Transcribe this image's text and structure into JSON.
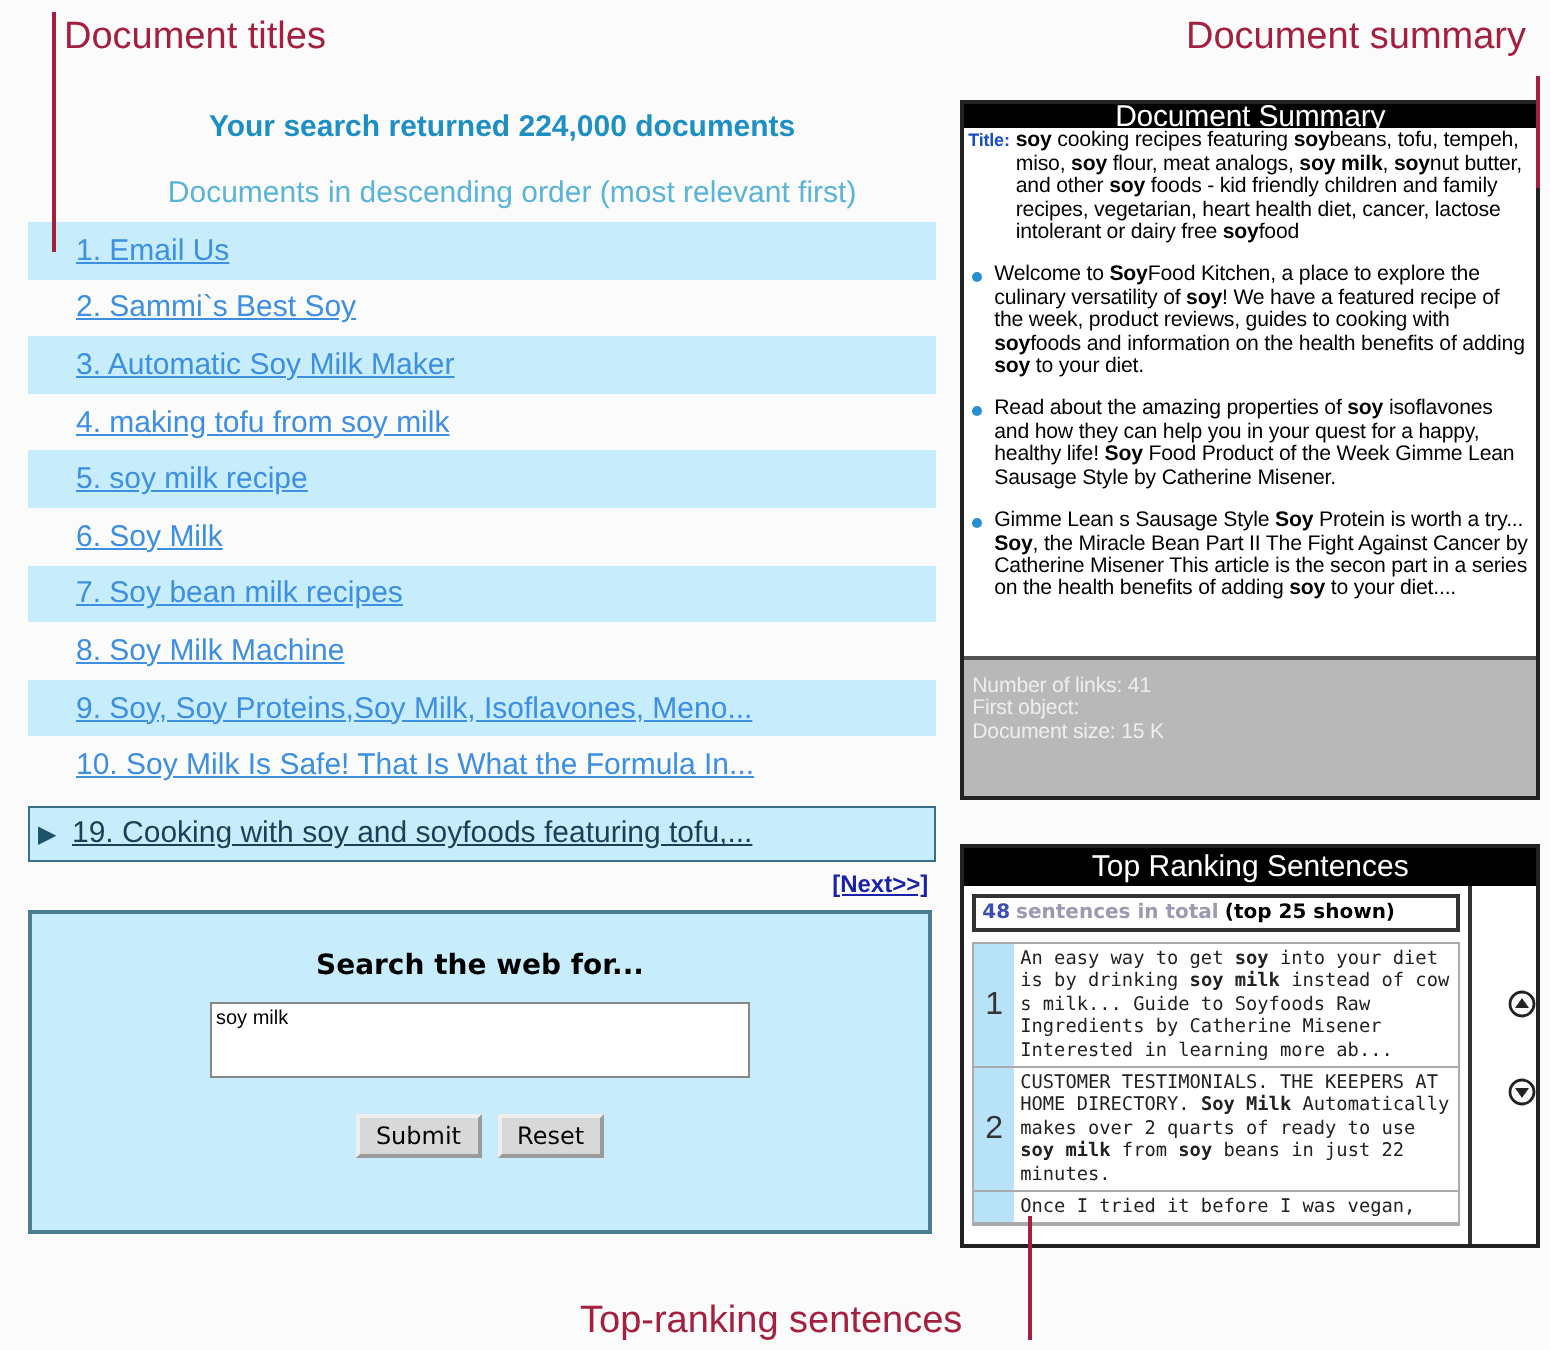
{
  "callouts": {
    "top_left": "Document titles",
    "top_right": "Document summary",
    "bottom": "Top-ranking sentences"
  },
  "results": {
    "heading": "Your search returned 224,000 documents",
    "subheading": "Documents in descending order (most relevant first)",
    "documents": [
      {
        "title": "1. Email Us",
        "selected": false
      },
      {
        "title": "2. Sammi`s Best Soy",
        "selected": false
      },
      {
        "title": "3. Automatic Soy Milk Maker",
        "selected": false
      },
      {
        "title": "4. making tofu from soy milk",
        "selected": false
      },
      {
        "title": "5. soy milk recipe",
        "selected": false
      },
      {
        "title": "6. Soy Milk",
        "selected": false
      },
      {
        "title": "7. Soy bean milk recipes",
        "selected": false
      },
      {
        "title": "8. Soy Milk Machine",
        "selected": false
      },
      {
        "title": "9. Soy, Soy Proteins,Soy Milk, Isoflavones, Meno...",
        "selected": false
      },
      {
        "title": "10. Soy Milk Is Safe! That Is What the Formula In...",
        "selected": false
      }
    ],
    "current": {
      "marker": "▶",
      "title": "19. Cooking with soy and soyfoods featuring tofu,...",
      "selected": true
    },
    "next": "[Next>>]"
  },
  "search_form": {
    "title": "Search the web for...",
    "value": "soy milk",
    "buttons": [
      "Submit",
      "Reset"
    ]
  },
  "summary": {
    "title": "Document Summary",
    "title_label": "Title:",
    "title_text": "**soy** cooking recipes featuring **soy**beans, tofu, tempeh, miso, **soy** flour, meat analogs, **soy milk**, **soy**nut butter, and other **soy** foods - kid friendly children and family recipes, vegetarian, heart health diet, cancer, lactose intolerant or dairy free **soy**food",
    "excerpts": [
      "Welcome to **Soy**Food Kitchen, a place to explore the culinary versatility of **soy**! We have a featured recipe of the week, product reviews, guides to cooking with **soy**foods and information on the health benefits of adding **soy** to your diet.",
      "Read about the amazing properties of **soy** isoflavones and how they can help you in your quest for a happy, healthy life! **Soy** Food Product of the Week Gimme Lean Sausage Style by Catherine Misener.",
      "Gimme Lean s Sausage Style **Soy** Protein is worth a try... **Soy**, the Miracle Bean Part II The Fight Against Cancer by Catherine Misener This article is the secon part in a series on the health benefits of adding **soy** to your diet...."
    ],
    "stats": [
      "Number of links: 41",
      "First object:",
      "Document size: 15 K"
    ]
  },
  "ranking": {
    "title": "Top Ranking Sentences",
    "count": "48",
    "count_label": "sentences in total",
    "shown": "(top 25 shown)",
    "sentences": [
      {
        "rank": "1",
        "text": "An easy way to get **soy** into your diet is by drinking **soy milk** instead of cow s milk... Guide to Soyfoods Raw Ingredients by Catherine Misener Interested in learning more ab..."
      },
      {
        "rank": "2",
        "text": "CUSTOMER TESTIMONIALS. THE KEEPERS AT HOME DIRECTORY. **Soy Milk** Automatically makes over 2 quarts of ready to use **soy milk** from **soy** beans in just 22 minutes."
      },
      {
        "text": "Once I tried it before I was vegan,"
      }
    ]
  }
}
